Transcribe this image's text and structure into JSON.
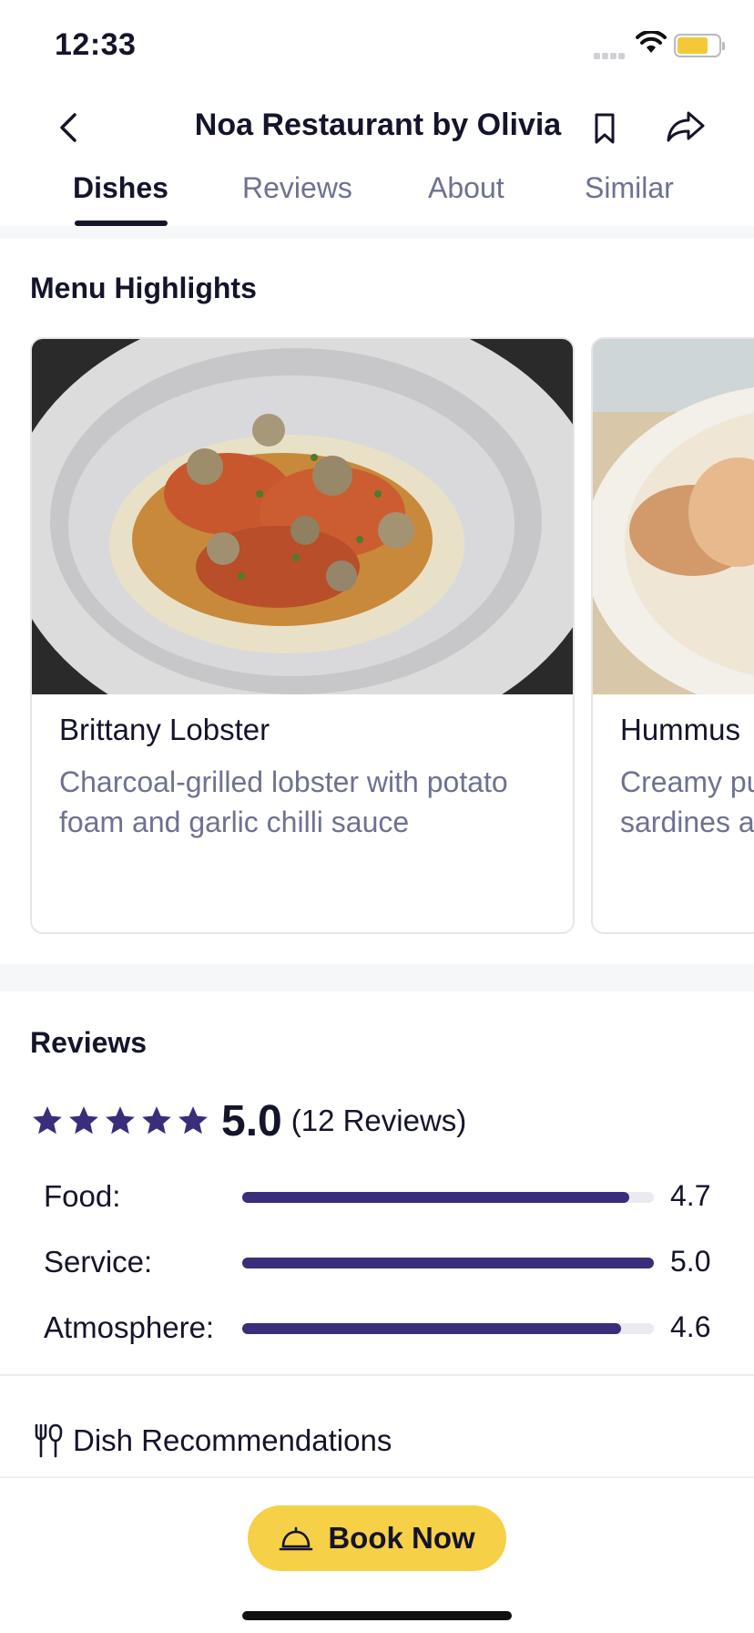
{
  "status_bar": {
    "time": "12:33"
  },
  "header": {
    "title": "Noa Restaurant by Olivia",
    "tabs": [
      {
        "label": "Dishes",
        "active": true
      },
      {
        "label": "Reviews",
        "active": false
      },
      {
        "label": "About",
        "active": false
      },
      {
        "label": "Similar",
        "active": false
      }
    ]
  },
  "menu_highlights": {
    "title": "Menu Highlights",
    "dishes": [
      {
        "name": "Brittany Lobster",
        "description": "Charcoal-grilled lobster with potato foam and garlic chilli sauce"
      },
      {
        "name": "Hummus",
        "description_visible": "Creamy pu",
        "description_visible_2": "sardines a"
      }
    ]
  },
  "reviews": {
    "title": "Reviews",
    "score": "5.0",
    "count_label": "(12 Reviews)",
    "stars": 5,
    "metrics": [
      {
        "label": "Food:",
        "value": "4.7",
        "fraction": 0.94
      },
      {
        "label": "Service:",
        "value": "5.0",
        "fraction": 1.0
      },
      {
        "label": "Atmosphere:",
        "value": "4.6",
        "fraction": 0.92
      }
    ]
  },
  "dish_recommendations": {
    "label": "Dish Recommendations"
  },
  "bottom_bar": {
    "book_label": "Book Now"
  },
  "colors": {
    "accent": "#3a2d7a",
    "button": "#f6d046",
    "muted_text": "#6e7191"
  }
}
